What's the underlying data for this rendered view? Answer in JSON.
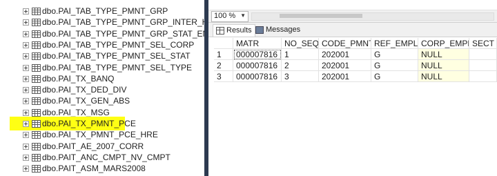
{
  "explorer": {
    "items": [
      {
        "label": "dbo.PAI_TAB_TYPE_PMNT_GRP"
      },
      {
        "label": "dbo.PAI_TAB_TYPE_PMNT_GRP_INTER_HOR"
      },
      {
        "label": "dbo.PAI_TAB_TYPE_PMNT_GRP_STAT_ENG"
      },
      {
        "label": "dbo.PAI_TAB_TYPE_PMNT_SEL_CORP"
      },
      {
        "label": "dbo.PAI_TAB_TYPE_PMNT_SEL_STAT"
      },
      {
        "label": "dbo.PAI_TAB_TYPE_PMNT_SEL_TYPE"
      },
      {
        "label": "dbo.PAI_TX_BANQ"
      },
      {
        "label": "dbo.PAI_TX_DED_DIV"
      },
      {
        "label": "dbo.PAI_TX_GEN_ABS"
      },
      {
        "label": "dbo.PAI_TX_MSG"
      },
      {
        "label": "dbo.PAI_TX_PMNT_PCE",
        "selected": true
      },
      {
        "label": "dbo.PAI_TX_PMNT_PCE_HRE"
      },
      {
        "label": "dbo.PAIT_AE_2007_CORR"
      },
      {
        "label": "dbo.PAIT_ANC_CMPT_NV_CMPT"
      },
      {
        "label": "dbo.PAIT_ASM_MARS2008"
      }
    ],
    "highlight_color": "#ffff14"
  },
  "toolbar": {
    "zoom": "100 %"
  },
  "tabs": {
    "results": "Results",
    "messages": "Messages"
  },
  "grid": {
    "columns": [
      "MATR",
      "NO_SEQ",
      "CODE_PMNT",
      "REF_EMPL",
      "CORP_EMPL",
      "SECT"
    ],
    "rows": [
      {
        "num": "1",
        "cells": [
          "000007816",
          "1",
          "202001",
          "G",
          "NULL",
          ""
        ]
      },
      {
        "num": "2",
        "cells": [
          "000007816",
          "2",
          "202001",
          "G",
          "NULL",
          ""
        ]
      },
      {
        "num": "3",
        "cells": [
          "000007816",
          "3",
          "202001",
          "G",
          "NULL",
          ""
        ]
      }
    ],
    "null_color": "#ffffe1"
  }
}
